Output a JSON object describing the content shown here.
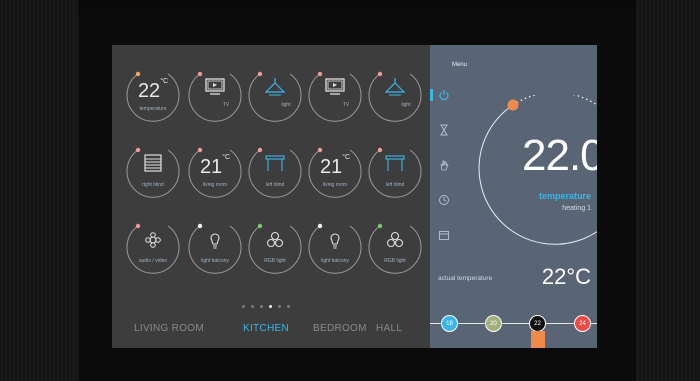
{
  "left_panel": {
    "tiles": [
      {
        "id": "temperature",
        "value": "22",
        "unit": "°C",
        "label": "temperature",
        "icon": "thermostat-icon",
        "dot": "#f5a66b"
      },
      {
        "id": "tv1",
        "label": "TV",
        "icon": "tv-icon",
        "dot": "#f19a9a"
      },
      {
        "id": "light1",
        "label": "light",
        "icon": "ceiling-light-icon",
        "dot": "#f19a9a"
      },
      {
        "id": "tv2",
        "label": "TV",
        "icon": "tv-icon",
        "dot": "#f19a9a"
      },
      {
        "id": "light2",
        "label": "light",
        "icon": "ceiling-light-icon",
        "dot": "#f19a9a"
      },
      {
        "id": "right_blind",
        "label": "right blind",
        "icon": "blind-icon",
        "dot": "#f19a9a"
      },
      {
        "id": "living_room_temp1",
        "value": "21",
        "unit": "°C",
        "label": "living room",
        "icon": "thermostat-icon",
        "dot": "#f19a9a"
      },
      {
        "id": "left_blind1",
        "label": "left blind",
        "icon": "blind-open-icon",
        "dot": "#f19a9a"
      },
      {
        "id": "living_room_temp2",
        "value": "21",
        "unit": "°C",
        "label": "living room",
        "icon": "thermostat-icon",
        "dot": "#f19a9a"
      },
      {
        "id": "left_blind2",
        "label": "left blind",
        "icon": "blind-open-icon",
        "dot": "#f19a9a"
      },
      {
        "id": "audio_video",
        "label": "audio / video",
        "icon": "speaker-icon",
        "dot": "#f19a9a"
      },
      {
        "id": "light_balcony1",
        "label": "light balcony",
        "icon": "bulb-icon",
        "dot": "#ffffff"
      },
      {
        "id": "rgb_light1",
        "label": "RGB light",
        "icon": "rgb-icon",
        "dot": "#7ac96f"
      },
      {
        "id": "light_balcony2",
        "label": "light balcony",
        "icon": "bulb-icon",
        "dot": "#ffffff"
      },
      {
        "id": "rgb_light2",
        "label": "RGB light",
        "icon": "rgb-icon",
        "dot": "#7ac96f"
      }
    ],
    "pager": {
      "count": 6,
      "active": 3
    },
    "rooms": [
      "LIVING ROOM",
      "KITCHEN",
      "BEDROOM",
      "HALL"
    ],
    "active_room": "KITCHEN"
  },
  "right_panel": {
    "menu_label": "Menu",
    "side_icons": [
      "power-icon",
      "hourglass-icon",
      "hand-icon",
      "clock-icon",
      "calendar-icon"
    ],
    "active_icon": "power-icon",
    "setpoint": "22.0",
    "mode_label": "temperature",
    "mode_sub": "heating 1",
    "actual_label": "actual temperature",
    "actual_value": "22°C",
    "presets": [
      {
        "value": "18",
        "color": "#3bb6e6"
      },
      {
        "value": "20",
        "color": "#a4b07a"
      },
      {
        "value": "22",
        "color": "#111111"
      },
      {
        "value": "24",
        "color": "#ee4a44"
      }
    ]
  },
  "colors": {
    "accent": "#38b7e9",
    "panel_left": "#3d3d3d",
    "panel_right": "#596575",
    "orange": "#f08a4b"
  }
}
